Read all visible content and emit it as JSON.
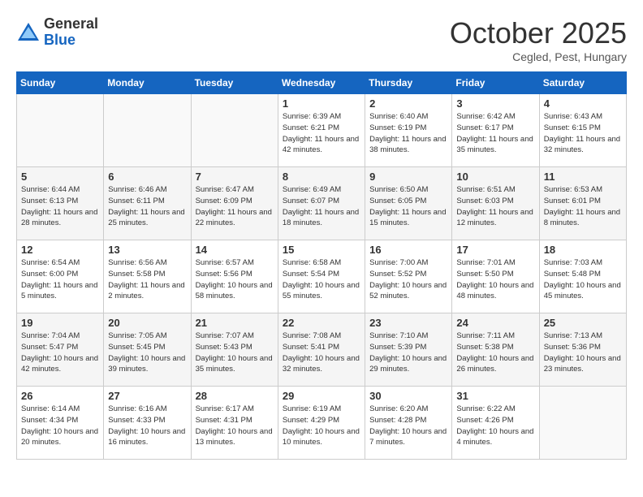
{
  "header": {
    "logo_general": "General",
    "logo_blue": "Blue",
    "title": "October 2025",
    "location": "Cegled, Pest, Hungary"
  },
  "weekdays": [
    "Sunday",
    "Monday",
    "Tuesday",
    "Wednesday",
    "Thursday",
    "Friday",
    "Saturday"
  ],
  "weeks": [
    [
      {
        "day": "",
        "info": ""
      },
      {
        "day": "",
        "info": ""
      },
      {
        "day": "",
        "info": ""
      },
      {
        "day": "1",
        "info": "Sunrise: 6:39 AM\nSunset: 6:21 PM\nDaylight: 11 hours\nand 42 minutes."
      },
      {
        "day": "2",
        "info": "Sunrise: 6:40 AM\nSunset: 6:19 PM\nDaylight: 11 hours\nand 38 minutes."
      },
      {
        "day": "3",
        "info": "Sunrise: 6:42 AM\nSunset: 6:17 PM\nDaylight: 11 hours\nand 35 minutes."
      },
      {
        "day": "4",
        "info": "Sunrise: 6:43 AM\nSunset: 6:15 PM\nDaylight: 11 hours\nand 32 minutes."
      }
    ],
    [
      {
        "day": "5",
        "info": "Sunrise: 6:44 AM\nSunset: 6:13 PM\nDaylight: 11 hours\nand 28 minutes."
      },
      {
        "day": "6",
        "info": "Sunrise: 6:46 AM\nSunset: 6:11 PM\nDaylight: 11 hours\nand 25 minutes."
      },
      {
        "day": "7",
        "info": "Sunrise: 6:47 AM\nSunset: 6:09 PM\nDaylight: 11 hours\nand 22 minutes."
      },
      {
        "day": "8",
        "info": "Sunrise: 6:49 AM\nSunset: 6:07 PM\nDaylight: 11 hours\nand 18 minutes."
      },
      {
        "day": "9",
        "info": "Sunrise: 6:50 AM\nSunset: 6:05 PM\nDaylight: 11 hours\nand 15 minutes."
      },
      {
        "day": "10",
        "info": "Sunrise: 6:51 AM\nSunset: 6:03 PM\nDaylight: 11 hours\nand 12 minutes."
      },
      {
        "day": "11",
        "info": "Sunrise: 6:53 AM\nSunset: 6:01 PM\nDaylight: 11 hours\nand 8 minutes."
      }
    ],
    [
      {
        "day": "12",
        "info": "Sunrise: 6:54 AM\nSunset: 6:00 PM\nDaylight: 11 hours\nand 5 minutes."
      },
      {
        "day": "13",
        "info": "Sunrise: 6:56 AM\nSunset: 5:58 PM\nDaylight: 11 hours\nand 2 minutes."
      },
      {
        "day": "14",
        "info": "Sunrise: 6:57 AM\nSunset: 5:56 PM\nDaylight: 10 hours\nand 58 minutes."
      },
      {
        "day": "15",
        "info": "Sunrise: 6:58 AM\nSunset: 5:54 PM\nDaylight: 10 hours\nand 55 minutes."
      },
      {
        "day": "16",
        "info": "Sunrise: 7:00 AM\nSunset: 5:52 PM\nDaylight: 10 hours\nand 52 minutes."
      },
      {
        "day": "17",
        "info": "Sunrise: 7:01 AM\nSunset: 5:50 PM\nDaylight: 10 hours\nand 48 minutes."
      },
      {
        "day": "18",
        "info": "Sunrise: 7:03 AM\nSunset: 5:48 PM\nDaylight: 10 hours\nand 45 minutes."
      }
    ],
    [
      {
        "day": "19",
        "info": "Sunrise: 7:04 AM\nSunset: 5:47 PM\nDaylight: 10 hours\nand 42 minutes."
      },
      {
        "day": "20",
        "info": "Sunrise: 7:05 AM\nSunset: 5:45 PM\nDaylight: 10 hours\nand 39 minutes."
      },
      {
        "day": "21",
        "info": "Sunrise: 7:07 AM\nSunset: 5:43 PM\nDaylight: 10 hours\nand 35 minutes."
      },
      {
        "day": "22",
        "info": "Sunrise: 7:08 AM\nSunset: 5:41 PM\nDaylight: 10 hours\nand 32 minutes."
      },
      {
        "day": "23",
        "info": "Sunrise: 7:10 AM\nSunset: 5:39 PM\nDaylight: 10 hours\nand 29 minutes."
      },
      {
        "day": "24",
        "info": "Sunrise: 7:11 AM\nSunset: 5:38 PM\nDaylight: 10 hours\nand 26 minutes."
      },
      {
        "day": "25",
        "info": "Sunrise: 7:13 AM\nSunset: 5:36 PM\nDaylight: 10 hours\nand 23 minutes."
      }
    ],
    [
      {
        "day": "26",
        "info": "Sunrise: 6:14 AM\nSunset: 4:34 PM\nDaylight: 10 hours\nand 20 minutes."
      },
      {
        "day": "27",
        "info": "Sunrise: 6:16 AM\nSunset: 4:33 PM\nDaylight: 10 hours\nand 16 minutes."
      },
      {
        "day": "28",
        "info": "Sunrise: 6:17 AM\nSunset: 4:31 PM\nDaylight: 10 hours\nand 13 minutes."
      },
      {
        "day": "29",
        "info": "Sunrise: 6:19 AM\nSunset: 4:29 PM\nDaylight: 10 hours\nand 10 minutes."
      },
      {
        "day": "30",
        "info": "Sunrise: 6:20 AM\nSunset: 4:28 PM\nDaylight: 10 hours\nand 7 minutes."
      },
      {
        "day": "31",
        "info": "Sunrise: 6:22 AM\nSunset: 4:26 PM\nDaylight: 10 hours\nand 4 minutes."
      },
      {
        "day": "",
        "info": ""
      }
    ]
  ]
}
